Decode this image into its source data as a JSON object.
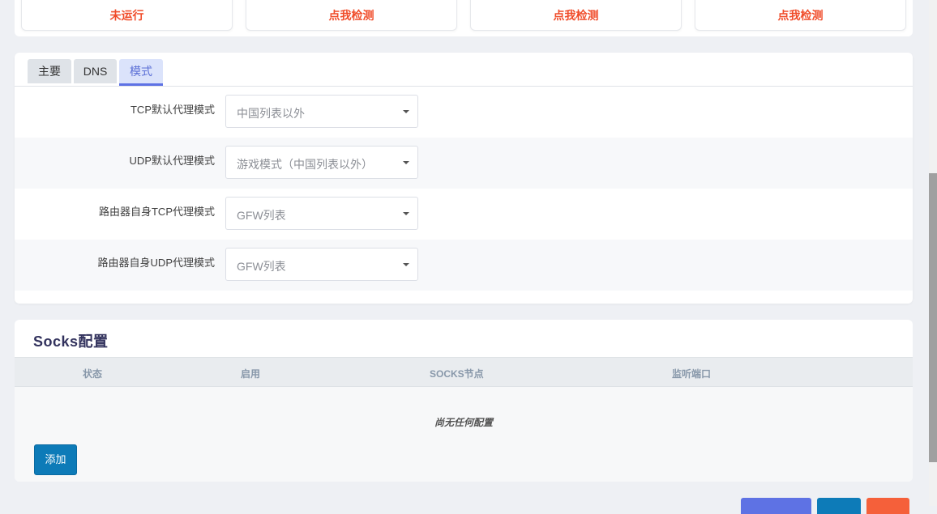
{
  "status_cards": [
    {
      "label": "未运行"
    },
    {
      "label": "点我检测"
    },
    {
      "label": "点我检测"
    },
    {
      "label": "点我检测"
    }
  ],
  "tabs": [
    {
      "label": "主要"
    },
    {
      "label": "DNS"
    },
    {
      "label": "模式"
    }
  ],
  "mode_rows": [
    {
      "label": "TCP默认代理模式",
      "value": "中国列表以外"
    },
    {
      "label": "UDP默认代理模式",
      "value": "游戏模式（中国列表以外）"
    },
    {
      "label": "路由器自身TCP代理模式",
      "value": "GFW列表"
    },
    {
      "label": "路由器自身UDP代理模式",
      "value": "GFW列表"
    }
  ],
  "socks": {
    "title": "Socks配置",
    "columns": [
      "状态",
      "启用",
      "SOCKS节点",
      "监听端口"
    ],
    "empty_message": "尚无任何配置",
    "add_label": "添加"
  },
  "colors": {
    "accent": "#5e72e4",
    "primary_button": "#0d7bb8",
    "danger": "#f5603a",
    "status_text": "#f04c2a"
  }
}
